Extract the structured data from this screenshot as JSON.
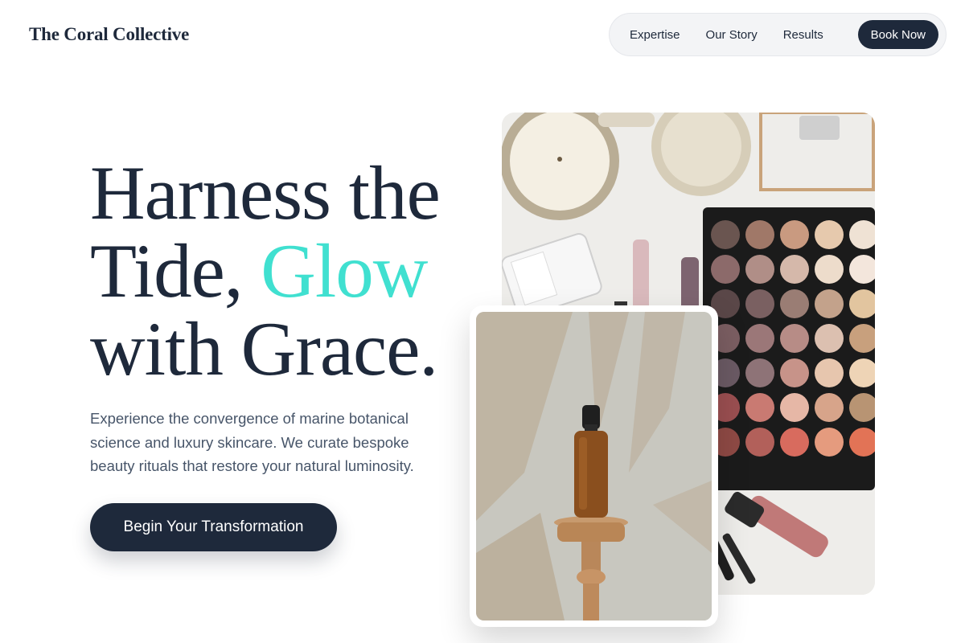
{
  "brand": {
    "name": "The Coral Collective"
  },
  "nav": {
    "links": [
      "Expertise",
      "Our Story",
      "Results"
    ],
    "cta": "Book Now"
  },
  "hero": {
    "headline_1": "Harness the",
    "headline_2": "Tide, ",
    "headline_accent": "Glow",
    "headline_3": "with Grace.",
    "description": "Experience the convergence of marine botanical science and luxury skincare. We curate bespoke beauty rituals that restore your natural luminosity.",
    "cta": "Begin Your Transformation"
  },
  "colors": {
    "navy": "#1e293b",
    "accent": "#40e0d0",
    "muted": "#475569"
  },
  "images": {
    "main": "makeup-flatlay-image",
    "front": "serum-bottle-image"
  }
}
